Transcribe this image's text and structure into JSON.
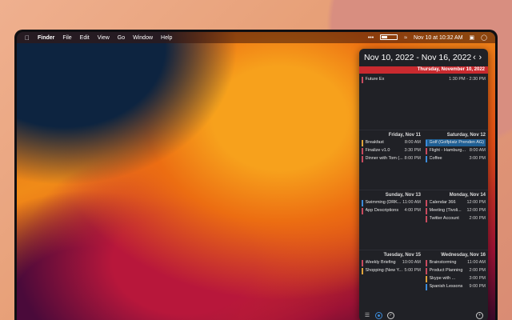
{
  "menubar": {
    "app": "Finder",
    "menus": [
      "File",
      "Edit",
      "View",
      "Go",
      "Window",
      "Help"
    ],
    "clock": "Nov 10 at 10:32 AM"
  },
  "calendar": {
    "title": "Nov 10, 2022 - Nov 16, 2022",
    "prev": "‹",
    "next": "›",
    "today": {
      "label": "Thursday, November 10, 2022",
      "events": [
        {
          "name": "Future Ex",
          "time": "1:30 PM - 2:30 PM",
          "color": "#c94b5f"
        }
      ]
    },
    "days": [
      {
        "label": "Friday, Nov 11",
        "events": [
          {
            "name": "Breakfast",
            "time": "8:00 AM",
            "color": "#e0a43a"
          },
          {
            "name": "Finalize v1.0",
            "time": "3:30 PM",
            "color": "#c94b5f"
          },
          {
            "name": "Dinner with Tom (...",
            "time": "8:00 PM",
            "color": "#c94b5f"
          }
        ]
      },
      {
        "label": "Saturday, Nov 12",
        "events": [
          {
            "name": "Golf (Golfplatz Prenden AG)",
            "time": "",
            "color": "#3c8bd9",
            "highlight": true
          },
          {
            "name": "Flight - Hamburg...",
            "time": "8:00 AM",
            "color": "#c94b5f"
          },
          {
            "name": "Coffee",
            "time": "3:00 PM",
            "color": "#3c8bd9"
          }
        ]
      },
      {
        "label": "Sunday, Nov 13",
        "events": [
          {
            "name": "Swimming (DRK...",
            "time": "11:00 AM",
            "color": "#3c8bd9"
          },
          {
            "name": "App Descriptions",
            "time": "4:00 PM",
            "color": "#c94b5f"
          }
        ]
      },
      {
        "label": "Monday, Nov 14",
        "events": [
          {
            "name": "Calendar 366",
            "time": "12:00 PM",
            "color": "#c94b5f"
          },
          {
            "name": "Meeting (Tivoli...",
            "time": "12:00 PM",
            "color": "#c94b5f"
          },
          {
            "name": "Twitter Account",
            "time": "2:00 PM",
            "color": "#c94b5f"
          }
        ]
      },
      {
        "label": "Tuesday, Nov 15",
        "events": [
          {
            "name": "Weekly Briefing",
            "time": "10:00 AM",
            "color": "#c94b5f"
          },
          {
            "name": "Shopping (New Y...",
            "time": "5:00 PM",
            "color": "#e0a43a"
          }
        ]
      },
      {
        "label": "Wednesday, Nov 16",
        "events": [
          {
            "name": "Brainstorming",
            "time": "11:00 AM",
            "color": "#c94b5f"
          },
          {
            "name": "Product Planning",
            "time": "2:00 PM",
            "color": "#c94b5f"
          },
          {
            "name": "Skype with ...",
            "time": "3:00 PM",
            "color": "#e0a43a"
          },
          {
            "name": "Spanish Lessons",
            "time": "9:00 PM",
            "color": "#3c8bd9"
          }
        ]
      }
    ]
  }
}
